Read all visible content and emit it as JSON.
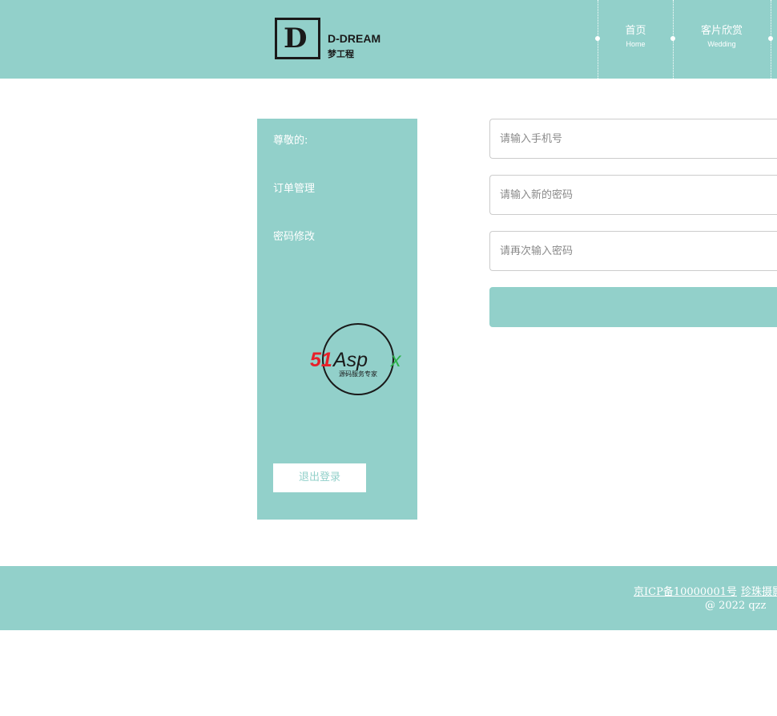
{
  "colors": {
    "brand": "#92d0ca",
    "text_on_brand": "#ffffff",
    "logo_dark": "#1a1a1a",
    "emblem_red": "#e8202a",
    "emblem_green": "#2db34a"
  },
  "header": {
    "logo": {
      "mark": "D",
      "name_en": "D-DREAM",
      "name_cn": "梦工程"
    },
    "nav": [
      {
        "label": "首页",
        "sub": "Home"
      },
      {
        "label": "客片欣赏",
        "sub": "Wedding"
      }
    ]
  },
  "sidebar": {
    "greeting": "尊敬的:",
    "items": [
      {
        "label": "订单管理"
      },
      {
        "label": "密码修改"
      }
    ],
    "emblem": {
      "brand_red": "51",
      "brand_dark": "Asp",
      "brand_green": "x",
      "tagline": "源码服务专家"
    },
    "logout_label": "退出登录"
  },
  "form": {
    "phone_placeholder": "请输入手机号",
    "new_password_placeholder": "请输入新的密码",
    "confirm_password_placeholder": "请再次输入密码",
    "submit_label": ""
  },
  "footer": {
    "icp": "京ICP备10000001号",
    "partner": "珍珠摄影",
    "copyright": "@ 2022 qzz"
  }
}
